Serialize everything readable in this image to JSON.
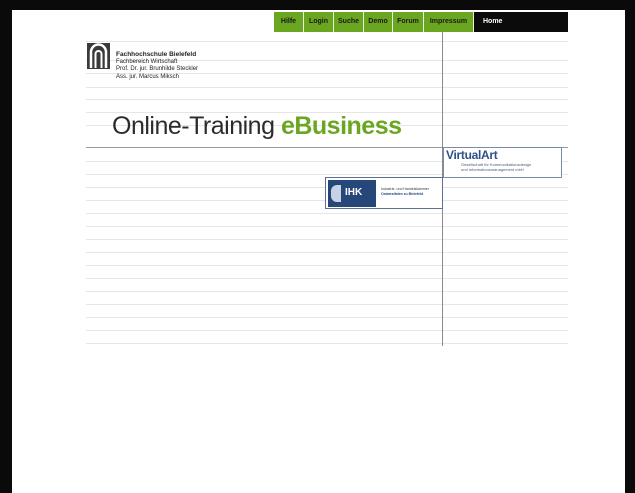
{
  "nav": {
    "items": [
      {
        "label": "Hilfe"
      },
      {
        "label": "Login"
      },
      {
        "label": "Suche"
      },
      {
        "label": "Demo"
      },
      {
        "label": "Forum"
      },
      {
        "label": "Impressum"
      },
      {
        "label": "Home"
      }
    ]
  },
  "org": {
    "name": "Fachhochschule Bielefeld",
    "department": "Fachbereich Wirtschaft",
    "professor": "Prof. Dr. jur. Brunhilde Steckler",
    "assistant": "Ass. jur. Marcus Miksch"
  },
  "title": {
    "prefix": "Online-Training",
    "accent": "eBusiness"
  },
  "partners": {
    "virtualart": {
      "name": "VirtualArt",
      "subtitle_1": "Gesellschaft für Kommunikationsdesign",
      "subtitle_2": "und Informationsmanagement mbH"
    },
    "ihk": {
      "abbr": "IHK",
      "line_1": "Industrie- und Handelskammer",
      "line_2": "Ostwestfalen zu Bielefeld"
    }
  },
  "colors": {
    "accent": "#6aa620",
    "nav_active": "#0b0b0b",
    "partner_blue": "#2e4f8a",
    "ihk_blue": "#26477a"
  }
}
